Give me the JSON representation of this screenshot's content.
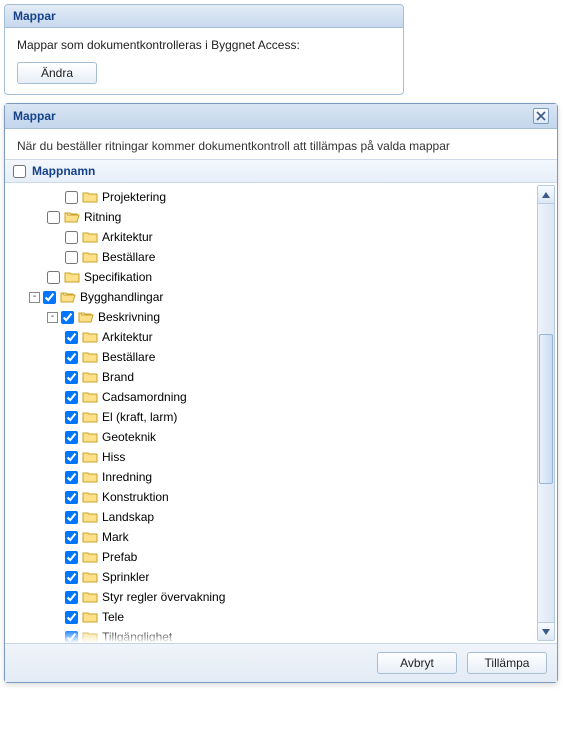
{
  "topPanel": {
    "title": "Mappar",
    "description": "Mappar som dokumentkontrolleras i Byggnet Access:",
    "changeLabel": "Ändra"
  },
  "dialog": {
    "title": "Mappar",
    "description": "När du beställer ritningar kommer dokumentkontroll att tillämpas på valda mappar",
    "columnHeader": "Mappnamn",
    "headerChecked": false,
    "cancelLabel": "Avbryt",
    "applyLabel": "Tillämpa"
  },
  "tree": [
    {
      "indent": 3,
      "expander": "",
      "checked": false,
      "open": false,
      "label": "Projektering"
    },
    {
      "indent": 2,
      "expander": "",
      "checked": false,
      "open": true,
      "label": "Ritning"
    },
    {
      "indent": 3,
      "expander": "",
      "checked": false,
      "open": false,
      "label": "Arkitektur"
    },
    {
      "indent": 3,
      "expander": "",
      "checked": false,
      "open": false,
      "label": "Beställare"
    },
    {
      "indent": 2,
      "expander": "",
      "checked": false,
      "open": false,
      "label": "Specifikation"
    },
    {
      "indent": 1,
      "expander": "-",
      "checked": true,
      "open": true,
      "label": "Bygghandlingar"
    },
    {
      "indent": 2,
      "expander": "-",
      "checked": true,
      "open": true,
      "label": "Beskrivning"
    },
    {
      "indent": 3,
      "expander": "",
      "checked": true,
      "open": false,
      "label": "Arkitektur"
    },
    {
      "indent": 3,
      "expander": "",
      "checked": true,
      "open": false,
      "label": "Beställare"
    },
    {
      "indent": 3,
      "expander": "",
      "checked": true,
      "open": false,
      "label": "Brand"
    },
    {
      "indent": 3,
      "expander": "",
      "checked": true,
      "open": false,
      "label": "Cadsamordning"
    },
    {
      "indent": 3,
      "expander": "",
      "checked": true,
      "open": false,
      "label": "El (kraft, larm)"
    },
    {
      "indent": 3,
      "expander": "",
      "checked": true,
      "open": false,
      "label": "Geoteknik"
    },
    {
      "indent": 3,
      "expander": "",
      "checked": true,
      "open": false,
      "label": "Hiss"
    },
    {
      "indent": 3,
      "expander": "",
      "checked": true,
      "open": false,
      "label": "Inredning"
    },
    {
      "indent": 3,
      "expander": "",
      "checked": true,
      "open": false,
      "label": "Konstruktion"
    },
    {
      "indent": 3,
      "expander": "",
      "checked": true,
      "open": false,
      "label": "Landskap"
    },
    {
      "indent": 3,
      "expander": "",
      "checked": true,
      "open": false,
      "label": "Mark"
    },
    {
      "indent": 3,
      "expander": "",
      "checked": true,
      "open": false,
      "label": "Prefab"
    },
    {
      "indent": 3,
      "expander": "",
      "checked": true,
      "open": false,
      "label": "Sprinkler"
    },
    {
      "indent": 3,
      "expander": "",
      "checked": true,
      "open": false,
      "label": "Styr regler övervakning"
    },
    {
      "indent": 3,
      "expander": "",
      "checked": true,
      "open": false,
      "label": "Tele"
    },
    {
      "indent": 3,
      "expander": "",
      "checked": true,
      "open": false,
      "label": "Tillgänglighet"
    }
  ]
}
